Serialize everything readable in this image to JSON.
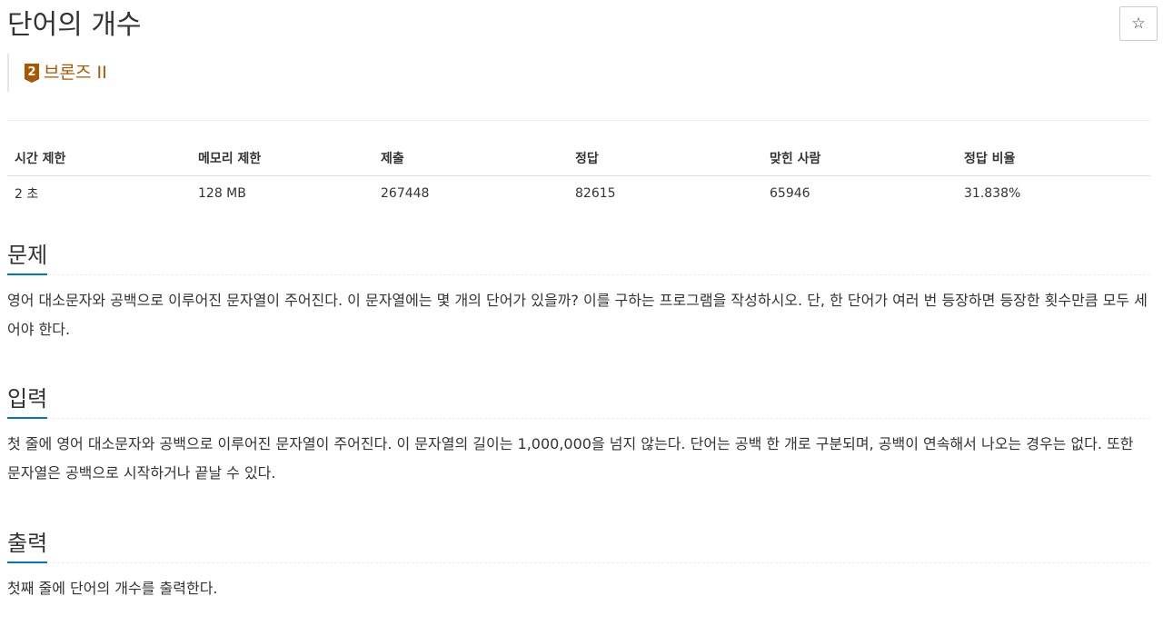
{
  "problem": {
    "title": "단어의 개수",
    "star_icon": "☆",
    "tier": {
      "badge_number": "2",
      "label": "브론즈 II",
      "color": "#ad5600"
    }
  },
  "stats": {
    "headers": [
      "시간 제한",
      "메모리 제한",
      "제출",
      "정답",
      "맞힌 사람",
      "정답 비율"
    ],
    "values": [
      "2 초",
      "128 MB",
      "267448",
      "82615",
      "65946",
      "31.838%"
    ]
  },
  "sections": {
    "description": {
      "title": "문제",
      "text": "영어 대소문자와 공백으로 이루어진 문자열이 주어진다. 이 문자열에는 몇 개의 단어가 있을까? 이를 구하는 프로그램을 작성하시오. 단, 한 단어가 여러 번 등장하면 등장한 횟수만큼 모두 세어야 한다."
    },
    "input": {
      "title": "입력",
      "text": "첫 줄에 영어 대소문자와 공백으로 이루어진 문자열이 주어진다. 이 문자열의 길이는 1,000,000을 넘지 않는다. 단어는 공백 한 개로 구분되며, 공백이 연속해서 나오는 경우는 없다. 또한 문자열은 공백으로 시작하거나 끝날 수 있다."
    },
    "output": {
      "title": "출력",
      "text": "첫째 줄에 단어의 개수를 출력한다."
    }
  },
  "colors": {
    "section_underline": "#0076c0",
    "tier_bronze": "#ad5600"
  }
}
